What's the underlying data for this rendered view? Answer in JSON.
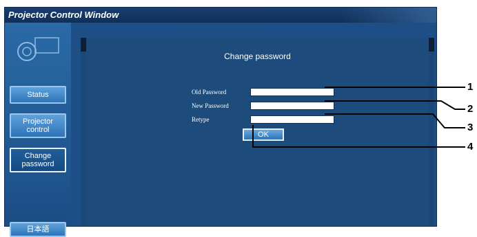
{
  "window": {
    "title": "Projector Control Window"
  },
  "sidebar": {
    "items": [
      {
        "label": "Status"
      },
      {
        "label": "Projector control"
      },
      {
        "label": "Change password"
      },
      {
        "label": "日本語"
      }
    ]
  },
  "main": {
    "heading": "Change password",
    "fields": [
      {
        "label": "Old Password",
        "value": ""
      },
      {
        "label": "New Password",
        "value": ""
      },
      {
        "label": "Retype",
        "value": ""
      }
    ],
    "ok_label": "OK"
  },
  "callouts": [
    "1",
    "2",
    "3",
    "4"
  ],
  "colors": {
    "window_bg": "#1d4f86",
    "titlebar": "#0f2f57",
    "button": "#2e74b7",
    "field": "#ffffff"
  }
}
